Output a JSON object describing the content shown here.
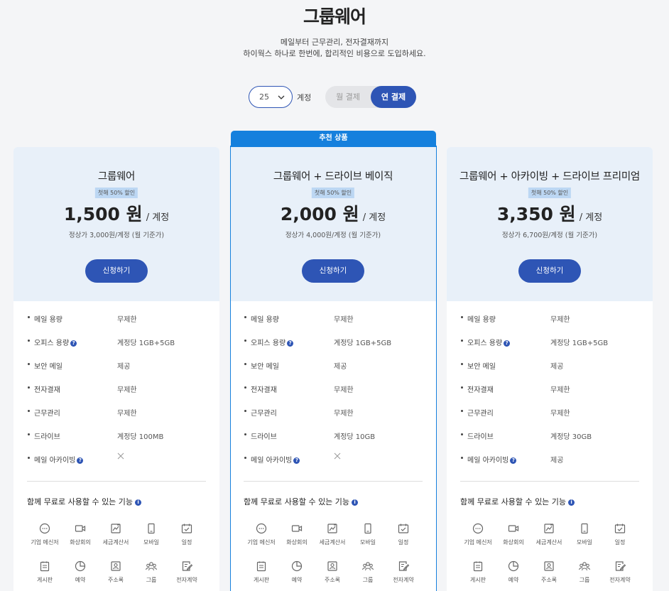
{
  "header": {
    "title": "그룹웨어",
    "subtitle_line1": "메일부터 근무관리, 전자결재까지",
    "subtitle_line2": "하이웍스 하나로 한번에, 합리적인 비용으로 도입하세요."
  },
  "controls": {
    "seat_count": "25",
    "seat_unit": "계정",
    "billing_monthly": "월 결제",
    "billing_annual": "연 결제",
    "selected_billing": "연 결제"
  },
  "recommended_label": "추천 상품",
  "colors": {
    "primary": "#2e55b5",
    "recommended": "#1580dd",
    "card_top": "#e8f0f9"
  },
  "plans": [
    {
      "name": "그룹웨어",
      "discount": "첫해 50% 할인",
      "price": "1,500 원",
      "price_unit": "/ 계정",
      "regular": "정상가 3,000원/계정 (월 기준가)",
      "cta": "신청하기",
      "features": [
        {
          "name": "메일 용량",
          "value": "무제한"
        },
        {
          "name": "오피스 용량",
          "value": "계정당 1GB+5GB",
          "help": true
        },
        {
          "name": "보안 메일",
          "value": "제공"
        },
        {
          "name": "전자결재",
          "value": "무제한"
        },
        {
          "name": "근무관리",
          "value": "무제한"
        },
        {
          "name": "드라이브",
          "value": "계정당 100MB"
        },
        {
          "name": "메일 아카이빙",
          "value": "",
          "help": true,
          "unavailable": true
        }
      ]
    },
    {
      "name": "그룹웨어 + 드라이브 베이직",
      "discount": "첫해 50% 할인",
      "price": "2,000 원",
      "price_unit": "/ 계정",
      "regular": "정상가 4,000원/계정 (월 기준가)",
      "cta": "신청하기",
      "features": [
        {
          "name": "메일 용량",
          "value": "무제한"
        },
        {
          "name": "오피스 용량",
          "value": "계정당 1GB+5GB",
          "help": true
        },
        {
          "name": "보안 메일",
          "value": "제공"
        },
        {
          "name": "전자결재",
          "value": "무제한"
        },
        {
          "name": "근무관리",
          "value": "무제한"
        },
        {
          "name": "드라이브",
          "value": "계정당 10GB"
        },
        {
          "name": "메일 아카이빙",
          "value": "",
          "help": true,
          "unavailable": true
        }
      ]
    },
    {
      "name": "그룹웨어 + 아카이빙 + 드라이브 프리미엄",
      "discount": "첫해 50% 할인",
      "price": "3,350 원",
      "price_unit": "/ 계정",
      "regular": "정상가 6,700원/계정 (월 기준가)",
      "cta": "신청하기",
      "features": [
        {
          "name": "메일 용량",
          "value": "무제한"
        },
        {
          "name": "오피스 용량",
          "value": "계정당 1GB+5GB",
          "help": true
        },
        {
          "name": "보안 메일",
          "value": "제공"
        },
        {
          "name": "전자결재",
          "value": "무제한"
        },
        {
          "name": "근무관리",
          "value": "무제한"
        },
        {
          "name": "드라이브",
          "value": "계정당 30GB"
        },
        {
          "name": "메일 아카이빙",
          "value": "제공",
          "help": true
        }
      ]
    }
  ],
  "free_features_title": "함께 무료로 사용할 수 있는 기능",
  "free_apps": [
    {
      "label": "기업 메신저",
      "icon": "chat-icon"
    },
    {
      "label": "화상회의",
      "icon": "video-icon"
    },
    {
      "label": "세금계산서",
      "icon": "tax-invoice-icon"
    },
    {
      "label": "모바일",
      "icon": "mobile-icon"
    },
    {
      "label": "일정",
      "icon": "calendar-icon"
    },
    {
      "label": "게시판",
      "icon": "board-icon"
    },
    {
      "label": "예약",
      "icon": "reservation-icon"
    },
    {
      "label": "주소록",
      "icon": "address-book-icon"
    },
    {
      "label": "그룹",
      "icon": "group-icon"
    },
    {
      "label": "전자계약",
      "icon": "e-contract-icon"
    }
  ]
}
